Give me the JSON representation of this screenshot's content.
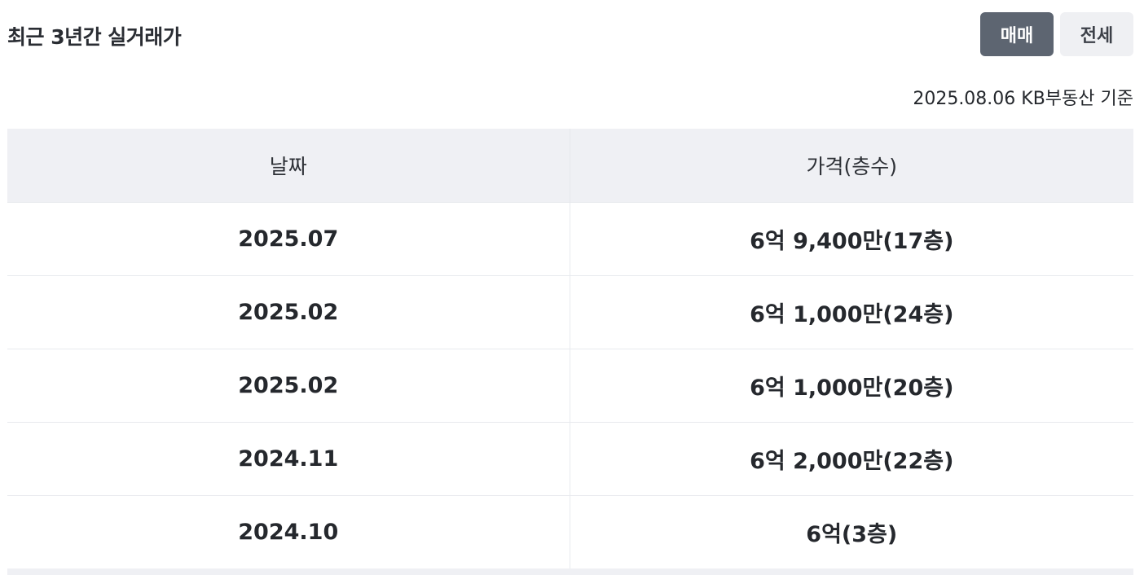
{
  "header": {
    "title": "최근 3년간 실거래가",
    "toggle": {
      "sale_label": "매매",
      "jeonse_label": "전세",
      "selected": "매매"
    }
  },
  "basis_text": "2025.08.06 KB부동산 기준",
  "table": {
    "columns": [
      "날짜",
      "가격(층수)"
    ],
    "rows": [
      {
        "date": "2025.07",
        "price": "6억 9,400만(17층)"
      },
      {
        "date": "2025.02",
        "price": "6억 1,000만(24층)"
      },
      {
        "date": "2025.02",
        "price": "6억 1,000만(20층)"
      },
      {
        "date": "2024.11",
        "price": "6억 2,000만(22층)"
      },
      {
        "date": "2024.10",
        "price": "6억(3층)"
      }
    ]
  },
  "colors": {
    "active_button": "#5d6571",
    "inactive_button": "#eff0f3",
    "header_bg": "#eff0f4"
  }
}
